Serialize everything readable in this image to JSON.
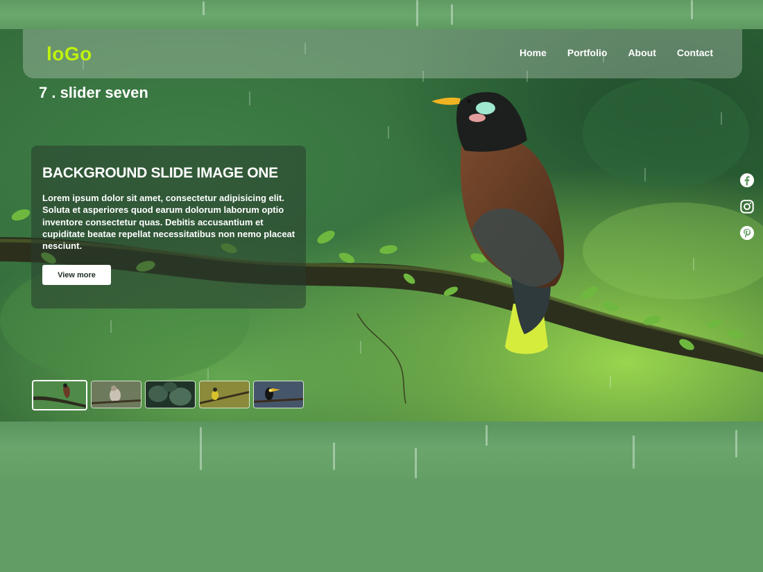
{
  "brand": {
    "logo_text": "loGo",
    "logo_color": "#bff20f"
  },
  "nav": {
    "items": [
      "Home",
      "Portfolio",
      "About",
      "Contact"
    ]
  },
  "slider": {
    "label": "7 . slider seven",
    "card": {
      "heading": "BACKGROUND SLIDE IMAGE ONE",
      "body": "Lorem ipsum dolor sit amet, consectetur adipisicing elit. Soluta et asperiores quod earum dolorum laborum optio inventore consectetur quas. Debitis accusantium et cupiditate beatae repellat necessitatibus non nemo placeat nesciunt.",
      "button_label": "View more"
    },
    "thumbnails": [
      {
        "name": "bird-on-branch-red",
        "active": true
      },
      {
        "name": "bird-small-grey",
        "active": false
      },
      {
        "name": "leaves",
        "active": false
      },
      {
        "name": "bird-yellow",
        "active": false
      },
      {
        "name": "toucan",
        "active": false
      }
    ]
  },
  "social": [
    {
      "icon": "facebook-icon"
    },
    {
      "icon": "instagram-icon"
    },
    {
      "icon": "pinterest-icon"
    }
  ],
  "colors": {
    "page_background": "#639d66",
    "accent": "#bff20f"
  }
}
